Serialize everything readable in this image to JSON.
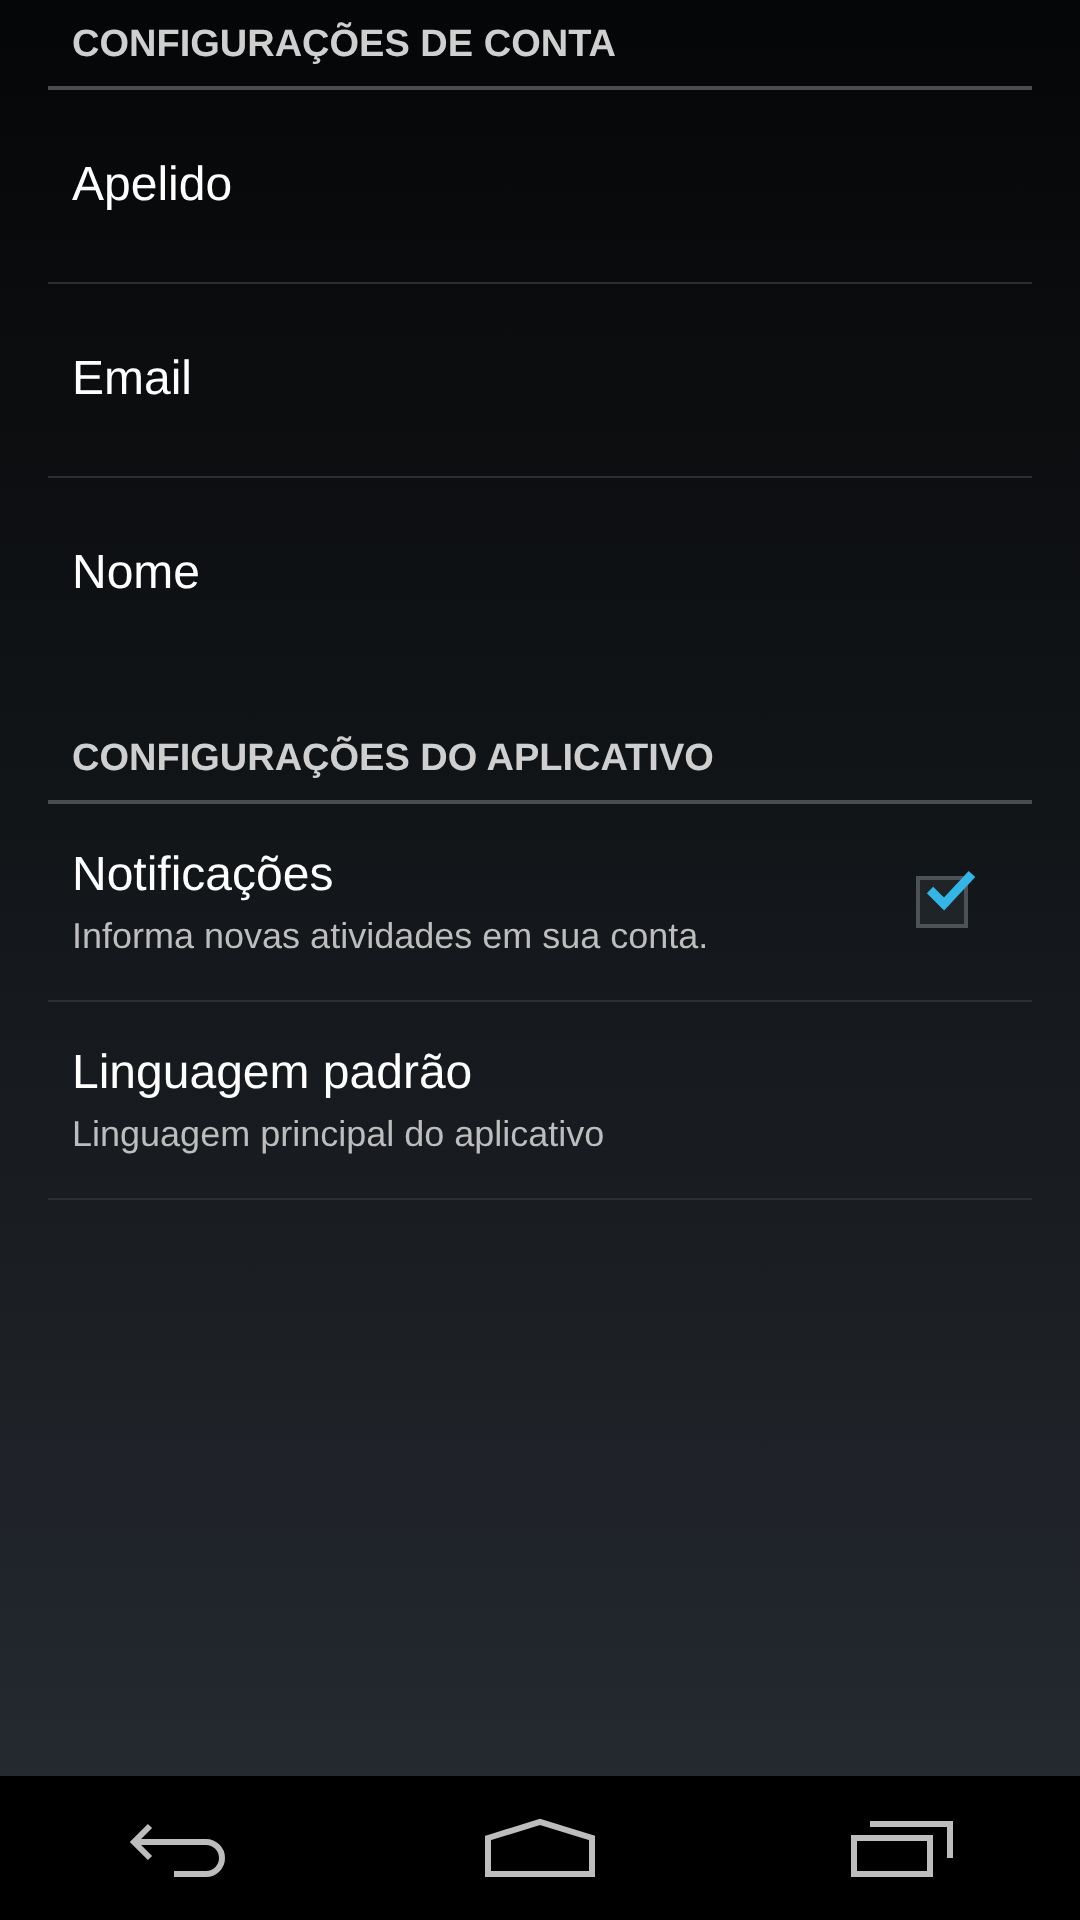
{
  "sections": [
    {
      "title": "CONFIGURAÇÕES DE CONTA",
      "items": [
        {
          "kind": "plain",
          "title": "Apelido"
        },
        {
          "kind": "plain",
          "title": "Email"
        },
        {
          "kind": "plain",
          "title": "Nome"
        }
      ]
    },
    {
      "title": "CONFIGURAÇÕES DO APLICATIVO",
      "items": [
        {
          "kind": "checkbox",
          "title": "Notificações",
          "summary": "Informa novas atividades em sua conta.",
          "checked": true
        },
        {
          "kind": "summary",
          "title": "Linguagem padrão",
          "summary": "Linguagem principal do aplicativo"
        }
      ]
    }
  ]
}
